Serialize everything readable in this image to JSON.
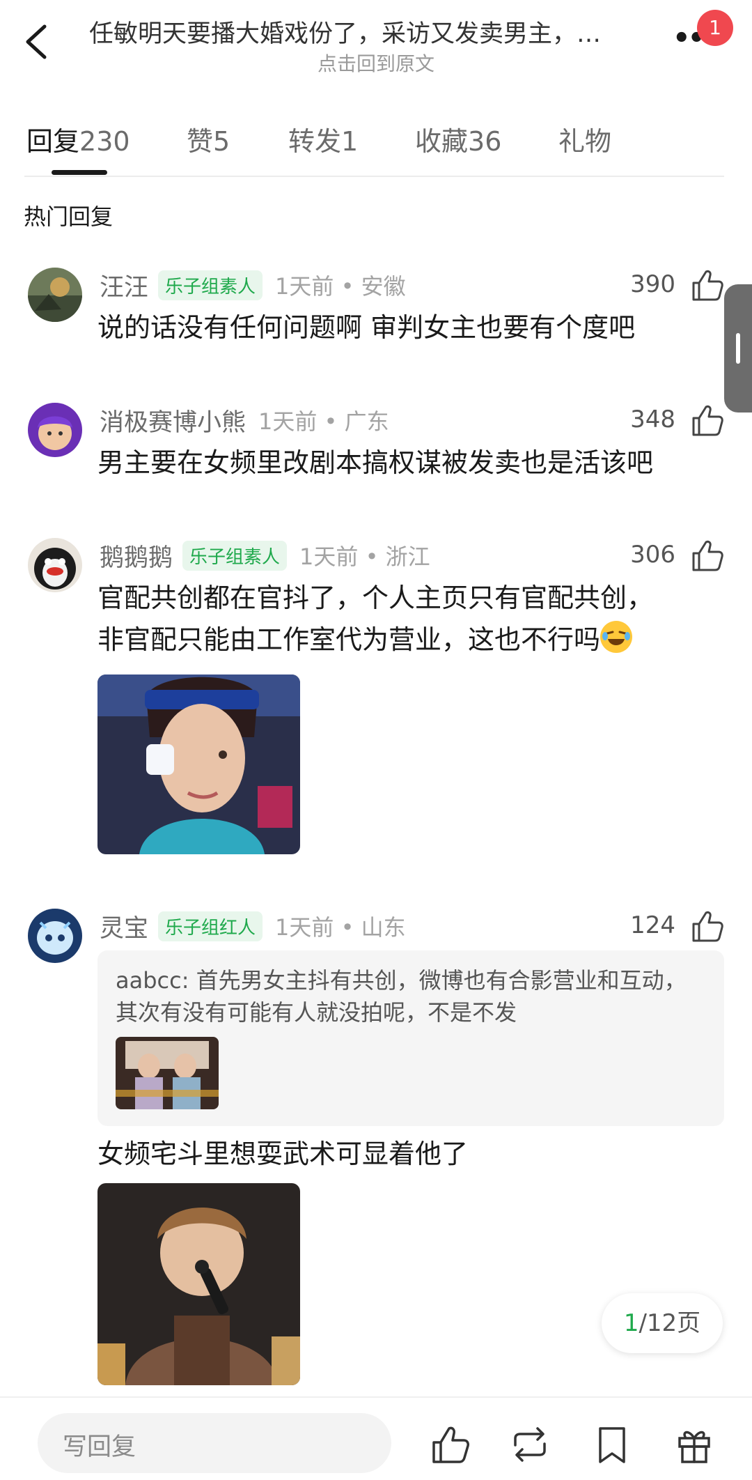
{
  "header": {
    "title": "任敏明天要播大婚戏份了，采访又发卖男主，…",
    "subtitle": "点击回到原文",
    "more_icon": "more-dots-icon",
    "badge_count": "1"
  },
  "tabs": [
    {
      "label": "回复",
      "count": "230",
      "active": true
    },
    {
      "label": "赞",
      "count": "5",
      "active": false
    },
    {
      "label": "转发",
      "count": "1",
      "active": false
    },
    {
      "label": "收藏",
      "count": "36",
      "active": false
    },
    {
      "label": "礼物",
      "count": "",
      "active": false
    }
  ],
  "section_title": "热门回复",
  "comments": [
    {
      "name": "汪汪",
      "badge": "乐子组素人",
      "time": "1天前 • 安徽",
      "likes": "390",
      "lines": [
        "说的话没有任何问题啊 审判女主也要有个度吧"
      ]
    },
    {
      "name": "消极赛博小熊",
      "badge": "",
      "time": "1天前 • 广东",
      "likes": "348",
      "lines": [
        "男主要在女频里改剧本搞权谋被发卖也是活该吧"
      ]
    },
    {
      "name": "鹅鹅鹅",
      "badge": "乐子组素人",
      "time": "1天前 • 浙江",
      "likes": "306",
      "lines": [
        "官配共创都在官抖了，个人主页只有官配共创，",
        "非官配只能由工作室代为营业，这也不行吗"
      ]
    },
    {
      "name": "灵宝",
      "badge": "乐子组红人",
      "time": "1天前 • 山东",
      "likes": "124",
      "quote": [
        "aabcc: 首先男女主抖有共创，微博也有合影营业和互动，",
        "其次有没有可能有人就没拍呢，不是不发"
      ],
      "lines": [
        "女频宅斗里想耍武术可显着他了"
      ]
    }
  ],
  "pager": {
    "current": "1",
    "total": "/12页"
  },
  "bottom_bar": {
    "reply_placeholder": "写回复",
    "icons": [
      "thumbs-up-icon",
      "repost-icon",
      "bookmark-icon",
      "gift-icon"
    ]
  },
  "colors": {
    "accent_green": "#1fa94c",
    "badge_red": "#f0484f",
    "text_primary": "#1a1a1a",
    "text_secondary": "#6b6b6b"
  }
}
